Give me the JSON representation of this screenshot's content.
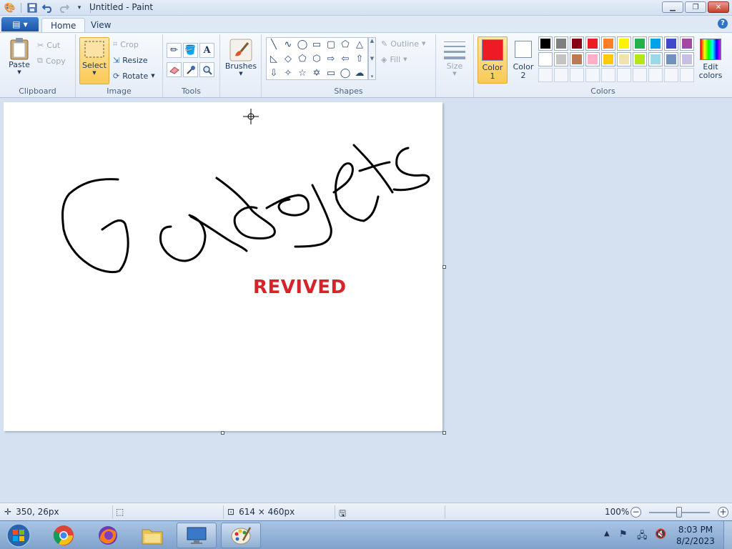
{
  "window": {
    "title": "Untitled - Paint",
    "minimize_icon": "minimize-icon",
    "maximize_icon": "restore-icon",
    "close_icon": "close-icon"
  },
  "tabs": {
    "file_menu_icon": "paint-menu-icon",
    "home": "Home",
    "view": "View"
  },
  "ribbon": {
    "clipboard": {
      "label": "Clipboard",
      "paste": "Paste",
      "cut": "Cut",
      "copy": "Copy"
    },
    "image": {
      "label": "Image",
      "select": "Select",
      "crop": "Crop",
      "resize": "Resize",
      "rotate": "Rotate"
    },
    "tools": {
      "label": "Tools"
    },
    "brushes": {
      "label": "Brushes"
    },
    "shapes": {
      "label": "Shapes",
      "outline": "Outline",
      "fill": "Fill"
    },
    "size": {
      "label": "Size"
    },
    "colors": {
      "label": "Colors",
      "color1_line1": "Color",
      "color1_line2": "1",
      "color2_line1": "Color",
      "color2_line2": "2",
      "edit_line1": "Edit",
      "edit_line2": "colors",
      "color1_value": "#ed1c24",
      "color2_value": "#ffffff",
      "palette": [
        "#000000",
        "#7f7f7f",
        "#880015",
        "#ed1c24",
        "#ff7f27",
        "#fff200",
        "#22b14c",
        "#00a2e8",
        "#3f48cc",
        "#a349a4",
        "#ffffff",
        "#c3c3c3",
        "#b97a57",
        "#ffaec9",
        "#ffc90e",
        "#efe4b0",
        "#b5e61d",
        "#99d9ea",
        "#7092be",
        "#c8bfe7"
      ]
    }
  },
  "canvas": {
    "drawing_handwriting": "Gadgets",
    "text": "REVIVED",
    "text_color": "#d8232a"
  },
  "status": {
    "cursor_pos": "350, 26px",
    "canvas_size": "614 × 460px",
    "zoom": "100%"
  },
  "taskbar": {
    "time": "8:03 PM",
    "date": "8/2/2023"
  }
}
